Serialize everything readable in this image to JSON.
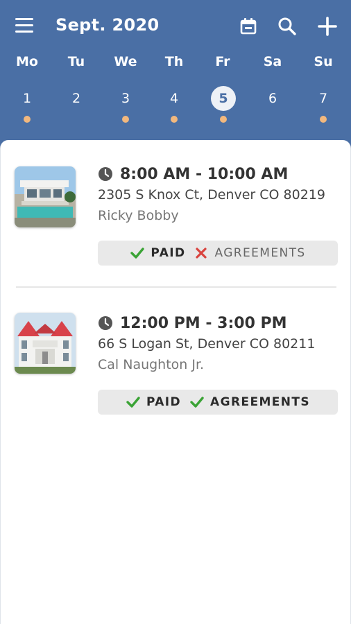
{
  "header": {
    "title": "Sept. 2020",
    "menu_icon": "hamburger-menu-icon",
    "calendar_icon": "calendar-icon",
    "search_icon": "search-icon",
    "add_icon": "plus-icon",
    "background_color": "#4a6fa5",
    "event_dot_color": "#f2b87e"
  },
  "week": {
    "days": [
      "Mo",
      "Tu",
      "We",
      "Th",
      "Fr",
      "Sa",
      "Su"
    ],
    "dates": [
      "1",
      "2",
      "3",
      "4",
      "5",
      "6",
      "7"
    ],
    "selected": "5",
    "dates_with_events": [
      "1",
      "3",
      "4",
      "5",
      "7"
    ]
  },
  "appointments": [
    {
      "time": "8:00 AM - 10:00 AM",
      "address": "2305 S Knox Ct, Denver CO 80219",
      "client": "Ricky Bobby",
      "thumbnail": "modern-house-with-pool-photo",
      "tags": [
        {
          "label": "PAID",
          "status": "done",
          "icon": "check-icon"
        },
        {
          "label": "AGREEMENTS",
          "status": "missing",
          "icon": "x-icon"
        }
      ]
    },
    {
      "time": "12:00 PM - 3:00 PM",
      "address": "66 S Logan St, Denver CO 80211",
      "client": "Cal Naughton Jr.",
      "thumbnail": "victorian-house-photo",
      "tags": [
        {
          "label": "PAID",
          "status": "done",
          "icon": "check-icon"
        },
        {
          "label": "AGREEMENTS",
          "status": "done",
          "icon": "check-icon"
        }
      ]
    }
  ],
  "colors": {
    "check": "#3aa335",
    "cross": "#d9443f"
  }
}
